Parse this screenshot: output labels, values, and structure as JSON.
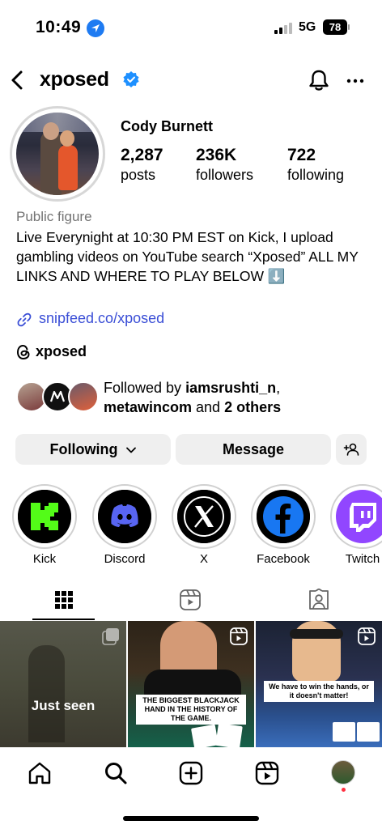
{
  "status_bar": {
    "time": "10:49",
    "network": "5G",
    "battery": "78"
  },
  "header": {
    "username": "xposed"
  },
  "profile": {
    "display_name": "Cody Burnett",
    "stats": [
      {
        "value": "2,287",
        "label": "posts"
      },
      {
        "value": "236K",
        "label": "followers"
      },
      {
        "value": "722",
        "label": "following"
      }
    ],
    "category": "Public figure",
    "bio": "Live Everynight at 10:30 PM EST on Kick, I upload gambling videos on YouTube search “Xposed” ALL MY LINKS AND WHERE TO PLAY BELOW ⬇️",
    "link": "snipfeed.co/xposed",
    "threads_handle": "xposed"
  },
  "followed_by": {
    "prefix": "Followed by ",
    "user1": "iamsrushti_n",
    "sep": ",",
    "user2": "metawincom",
    "middle": " and ",
    "others": "2 others"
  },
  "buttons": {
    "following": "Following",
    "message": "Message"
  },
  "highlights": [
    {
      "label": "Kick",
      "icon": "kick-logo-icon"
    },
    {
      "label": "Discord",
      "icon": "discord-logo-icon"
    },
    {
      "label": "X",
      "icon": "x-logo-icon"
    },
    {
      "label": "Facebook",
      "icon": "facebook-logo-icon"
    },
    {
      "label": "Twitch",
      "icon": "twitch-logo-icon"
    }
  ],
  "tabs": [
    "grid-icon",
    "reels-icon",
    "tagged-icon"
  ],
  "posts": [
    {
      "overlay": "Just seen"
    },
    {
      "caption": "THE BIGGEST BLACKJACK HAND IN THE HISTORY OF THE GAME."
    },
    {
      "caption": "We have to win the hands, or it doesn't matter!"
    }
  ],
  "colors": {
    "link": "#3a4ed6",
    "verified": "#1e90ff",
    "button_bg": "#efefef",
    "notification_dot": "#ff3040"
  }
}
